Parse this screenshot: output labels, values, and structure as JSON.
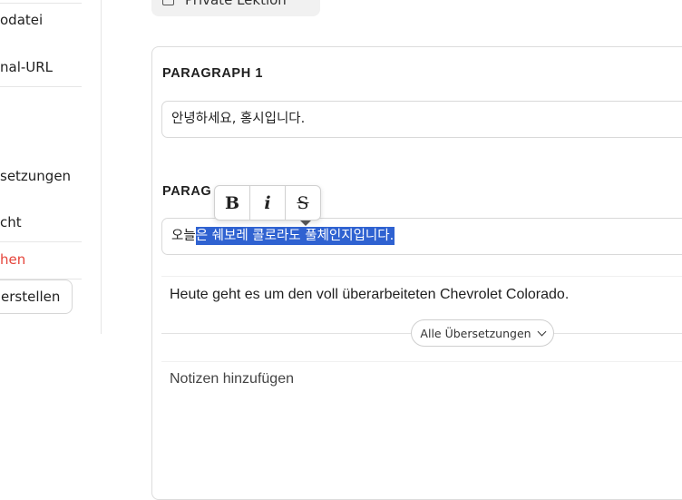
{
  "sidebar": {
    "items": [
      {
        "label": "odatei"
      },
      {
        "label": "nal-URL"
      },
      {
        "label": "setzungen"
      },
      {
        "label": "cht"
      },
      {
        "label": "hen"
      }
    ],
    "button_label": "erstellen"
  },
  "header": {
    "chip_label": "Private Lektion"
  },
  "paragraphs": [
    {
      "label": "PARAGRAPH 1",
      "text": "안녕하세요, 홍시입니다."
    },
    {
      "label": "PARAG",
      "text_unselected": "오늘",
      "text_selected": "은 쉐보레 콜로라도 풀체인지입니다."
    }
  ],
  "toolbar": {
    "bold": "B",
    "italic": "i",
    "strike": "S"
  },
  "translation": {
    "text": "Heute geht es um den voll überarbeiteten Chevrolet Colorado."
  },
  "all_translations_label": "Alle Übersetzungen",
  "notes_placeholder": "Notizen hinzufügen",
  "colors": {
    "selection": "#2f62d1",
    "danger": "#e5443a"
  }
}
